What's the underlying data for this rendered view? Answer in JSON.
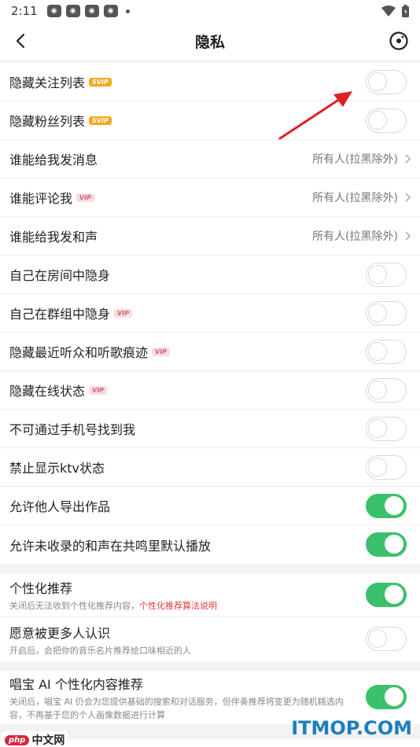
{
  "status_bar": {
    "time": "2:11",
    "notification_icons": [
      "app-notification-icon",
      "app-notification-icon",
      "app-notification-icon",
      "app-notification-icon"
    ],
    "wifi_icon": "wifi-icon",
    "battery_icon": "battery-icon"
  },
  "header": {
    "title": "隐私",
    "back_icon": "back-arrow-icon",
    "right_icon": "record-icon"
  },
  "group1": [
    {
      "label": "隐藏关注列表",
      "badge": "SVIP",
      "control": "toggle",
      "on": false
    },
    {
      "label": "隐藏粉丝列表",
      "badge": "SVIP",
      "control": "toggle",
      "on": false
    },
    {
      "label": "谁能给我发消息",
      "control": "value",
      "value": "所有人(拉黑除外)"
    },
    {
      "label": "谁能评论我",
      "badge": "VIP",
      "control": "value",
      "value": "所有人(拉黑除外)"
    },
    {
      "label": "谁能给我发和声",
      "control": "value",
      "value": "所有人(拉黑除外)"
    },
    {
      "label": "自己在房间中隐身",
      "control": "toggle",
      "on": false
    },
    {
      "label": "自己在群组中隐身",
      "badge": "VIP",
      "control": "toggle",
      "on": false
    },
    {
      "label": "隐藏最近听众和听歌痕迹",
      "badge": "VIP",
      "control": "toggle",
      "on": false
    },
    {
      "label": "隐藏在线状态",
      "badge": "VIP",
      "control": "toggle",
      "on": false
    },
    {
      "label": "不可通过手机号找到我",
      "control": "toggle",
      "on": false
    },
    {
      "label": "禁止显示ktv状态",
      "control": "toggle",
      "on": false
    },
    {
      "label": "允许他人导出作品",
      "control": "toggle",
      "on": true
    },
    {
      "label": "允许未收录的和声在共鸣里默认播放",
      "control": "toggle",
      "on": true
    }
  ],
  "group2": [
    {
      "label": "个性化推荐",
      "desc": "关闭后无法收到个性化推荐内容，",
      "link": "个性化推荐算法说明",
      "on": true
    },
    {
      "label": "愿意被更多人认识",
      "desc": "开启后，会把你的音乐名片推荐给口味相近的人",
      "on": false
    }
  ],
  "group3": {
    "label": "唱宝 AI 个性化内容推荐",
    "desc": "关闭后，唱宝 AI 仍会为您提供基础的搜索和对话服务，但伴奏推荐将变更为随机精选内容，不再基于您的个人画像数据进行计算",
    "on": true
  },
  "watermark": {
    "site": "ITMOP.COM",
    "logo": "php",
    "cn": "中文网"
  },
  "colors": {
    "toggle_on": "#3bc16b",
    "link": "#e5383b",
    "svip_badge": "#f7a823",
    "vip_badge": "#f8dcdf",
    "arrow": "#e02020"
  }
}
